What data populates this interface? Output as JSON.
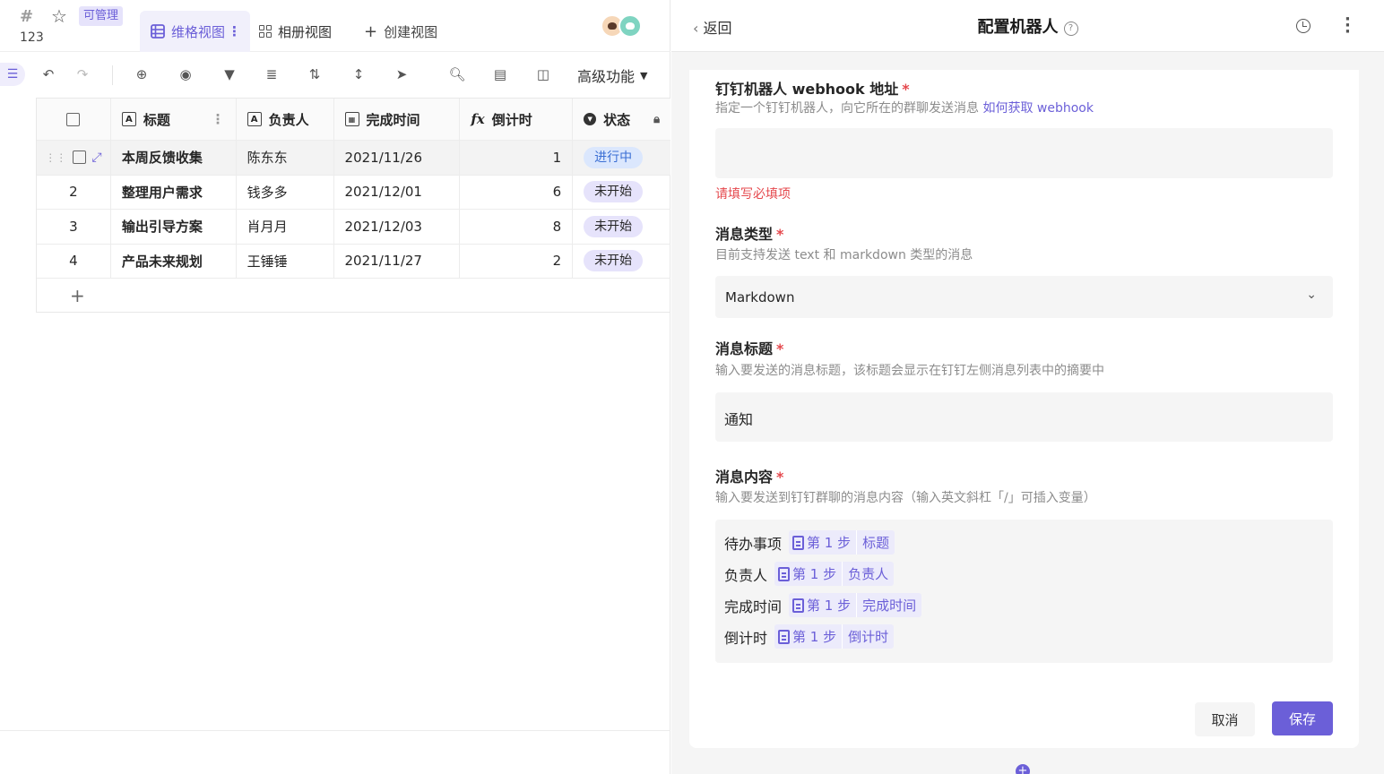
{
  "left": {
    "header": {
      "table_name": "123",
      "manage_badge": "可管理",
      "tabs": [
        {
          "label": "维格视图",
          "active": true
        },
        {
          "label": "相册视图",
          "active": false
        }
      ],
      "create_view_label": "创建视图",
      "create_view_icon": "plus"
    },
    "toolbar": {
      "advanced_label": "高级功能"
    },
    "grid": {
      "columns": [
        {
          "label": "标题",
          "icon": "text-icon"
        },
        {
          "label": "负责人",
          "icon": "text-icon"
        },
        {
          "label": "完成时间",
          "icon": "calendar-icon"
        },
        {
          "label": "倒计时",
          "icon": "formula-icon"
        },
        {
          "label": "状态",
          "icon": "select-icon"
        }
      ],
      "rows": [
        {
          "index": "",
          "title": "本周反馈收集",
          "owner": "陈东东",
          "date": "2021/11/26",
          "countdown": "1",
          "status": "进行中",
          "status_color": "#dbe7fd",
          "status_text_color": "#3b6fd4"
        },
        {
          "index": "2",
          "title": "整理用户需求",
          "owner": "钱多多",
          "date": "2021/12/01",
          "countdown": "6",
          "status": "未开始",
          "status_color": "#e6e3fb",
          "status_text_color": "#262626"
        },
        {
          "index": "3",
          "title": "输出引导方案",
          "owner": "肖月月",
          "date": "2021/12/03",
          "countdown": "8",
          "status": "未开始",
          "status_color": "#e6e3fb",
          "status_text_color": "#262626"
        },
        {
          "index": "4",
          "title": "产品未来规划",
          "owner": "王锤锤",
          "date": "2021/11/27",
          "countdown": "2",
          "status": "未开始",
          "status_color": "#e6e3fb",
          "status_text_color": "#262626"
        }
      ],
      "add_row": "+"
    }
  },
  "right": {
    "back_label": "返回",
    "title": "配置机器人",
    "fields": {
      "webhook": {
        "label": "钉钉机器人 webhook 地址",
        "required": "*",
        "desc": "指定一个钉钉机器人，向它所在的群聊发送消息",
        "link": "如何获取 webhook",
        "value": "",
        "error": "请填写必填项"
      },
      "msg_type": {
        "label": "消息类型",
        "required": "*",
        "desc": "目前支持发送 text 和 markdown 类型的消息",
        "value": "Markdown"
      },
      "msg_title": {
        "label": "消息标题",
        "required": "*",
        "desc": "输入要发送的消息标题，该标题会显示在钉钉左侧消息列表中的摘要中",
        "value": "通知"
      },
      "msg_content": {
        "label": "消息内容",
        "required": "*",
        "desc": "输入要发送到钉钉群聊的消息内容（输入英文斜杠「/」可插入变量）",
        "lines": [
          {
            "text": "待办事项",
            "step": "第 1 步",
            "field": "标题"
          },
          {
            "text": "负责人",
            "step": "第 1 步",
            "field": "负责人"
          },
          {
            "text": "完成时间",
            "step": "第 1 步",
            "field": "完成时间"
          },
          {
            "text": "倒计时",
            "step": "第 1 步",
            "field": "倒计时"
          }
        ]
      }
    },
    "cancel_label": "取消",
    "save_label": "保存",
    "accent": "#6b5fd8"
  }
}
